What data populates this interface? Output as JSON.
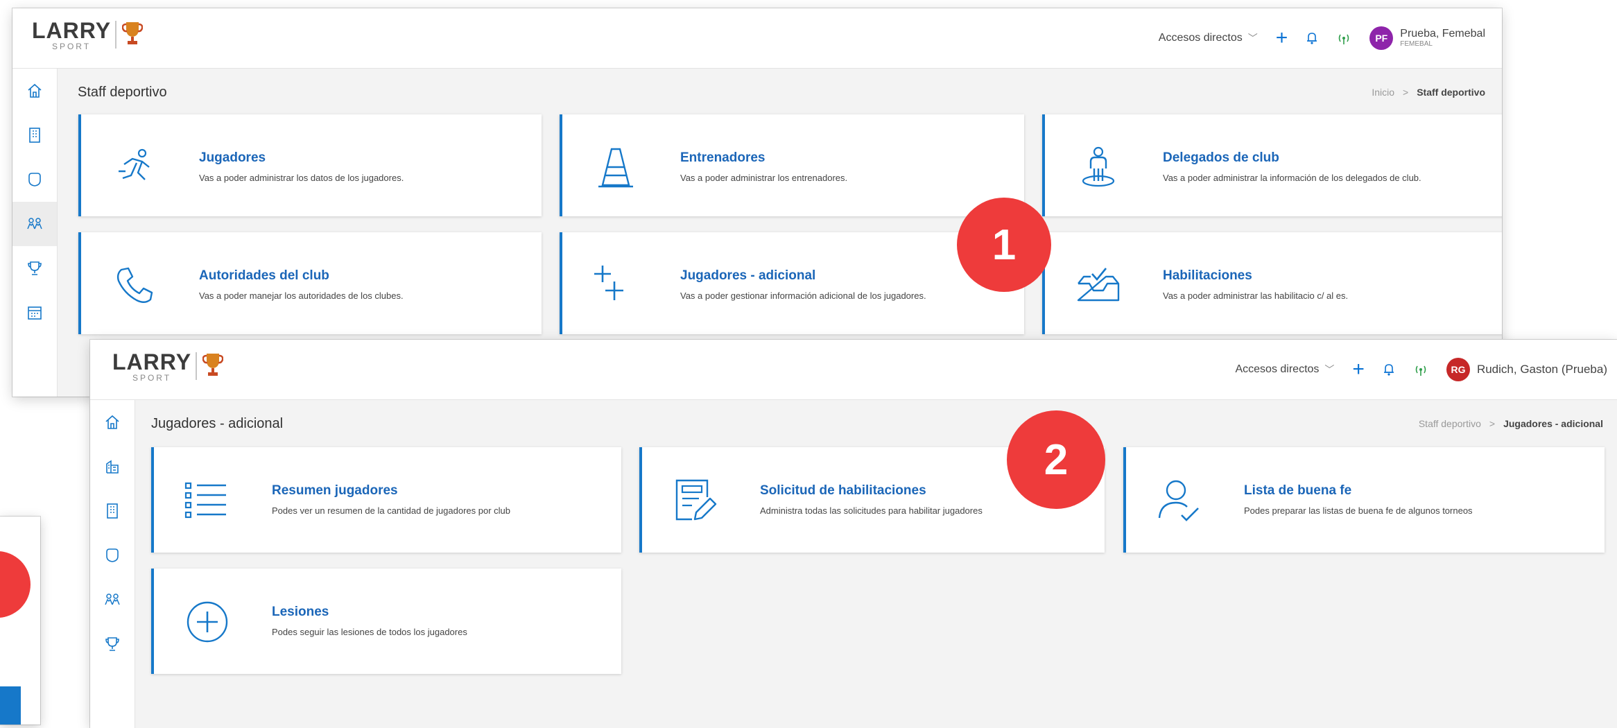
{
  "window1": {
    "logo": {
      "brand": "LARRY",
      "sub": "SPORT"
    },
    "header": {
      "shortcuts_label": "Accesos directos",
      "user_initials": "PF",
      "user_name": "Prueba, Femebal",
      "user_org": "FEMEBAL",
      "avatar_color": "#8e24aa"
    },
    "sidebar": [
      "home-icon",
      "building-icon",
      "shield-icon",
      "people-icon",
      "trophy-icon",
      "calendar-icon"
    ],
    "page_title": "Staff deportivo",
    "breadcrumb": {
      "home": "Inicio",
      "current": "Staff deportivo"
    },
    "cards": [
      {
        "icon": "runner-icon",
        "title": "Jugadores",
        "desc": "Vas a poder administrar los datos de los jugadores."
      },
      {
        "icon": "cone-icon",
        "title": "Entrenadores",
        "desc": "Vas a poder administrar los entrenadores."
      },
      {
        "icon": "delegate-icon",
        "title": "Delegados de club",
        "desc": "Vas a poder administrar la información de los delegados de club."
      },
      {
        "icon": "phone-icon",
        "title": "Autoridades del club",
        "desc": "Vas a poder manejar los autoridades de los clubes."
      },
      {
        "icon": "plus-plus-icon",
        "title": "Jugadores - adicional",
        "desc": "Vas a poder gestionar información adicional de los jugadores."
      },
      {
        "icon": "inbox-check-icon",
        "title": "Habilitaciones",
        "desc": "Vas a poder administrar las habilitacio    c/   al     es."
      }
    ]
  },
  "window2": {
    "logo": {
      "brand": "LARRY",
      "sub": "SPORT"
    },
    "header": {
      "shortcuts_label": "Accesos directos",
      "user_initials": "RG",
      "user_name": "Rudich, Gaston (Prueba)",
      "avatar_color": "#c62828"
    },
    "sidebar": [
      "home-icon",
      "buildings-icon",
      "building-icon",
      "shield-icon",
      "people-icon",
      "trophy-icon"
    ],
    "page_title": "Jugadores - adicional",
    "breadcrumb": {
      "parent": "Staff deportivo",
      "current": "Jugadores - adicional"
    },
    "cards": [
      {
        "icon": "list-icon",
        "title": "Resumen jugadores",
        "desc": "Podes ver un resumen de la cantidad de jugadores por club"
      },
      {
        "icon": "form-edit-icon",
        "title": "Solicitud de habilitaciones",
        "desc": "Administra todas las solicitudes para habilitar jugadores"
      },
      {
        "icon": "user-check-icon",
        "title": "Lista de buena fe",
        "desc": "Podes preparar las listas de buena fe de algunos torneos"
      },
      {
        "icon": "plus-circle-icon",
        "title": "Lesiones",
        "desc": "Podes seguir las lesiones de todos los jugadores"
      }
    ]
  },
  "badges": [
    "1",
    "2"
  ],
  "colors": {
    "accent": "#1678c9",
    "badge": "#ee3b3b",
    "title_link": "#1b66b8"
  }
}
